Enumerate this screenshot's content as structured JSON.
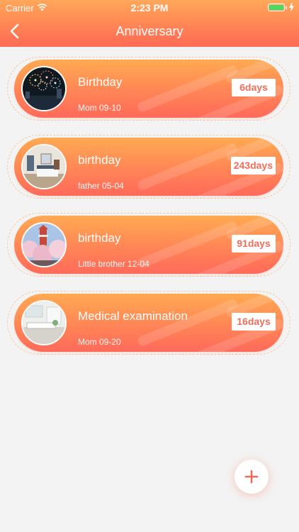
{
  "status_bar": {
    "carrier": "Carrier",
    "time": "2:23 PM"
  },
  "nav": {
    "title": "Anniversary"
  },
  "anniversaries": [
    {
      "title": "Birthday",
      "subtitle": "Mom 09-10",
      "days": "6days",
      "photo": "fireworks"
    },
    {
      "title": "birthday",
      "subtitle": "father 05-04",
      "days": "243days",
      "photo": "bedroom"
    },
    {
      "title": "birthday",
      "subtitle": "Little brother 12-04",
      "days": "91days",
      "photo": "cherry-blossom-tower"
    },
    {
      "title": "Medical examination",
      "subtitle": "Mom 09-20",
      "days": "16days",
      "photo": "kitchen"
    }
  ],
  "fab": {
    "icon": "plus-icon"
  },
  "colors": {
    "accent": "#ff7a56",
    "accent_light": "#ffaa52",
    "days_text": "#f36d5b",
    "background": "#f3f3f3"
  }
}
